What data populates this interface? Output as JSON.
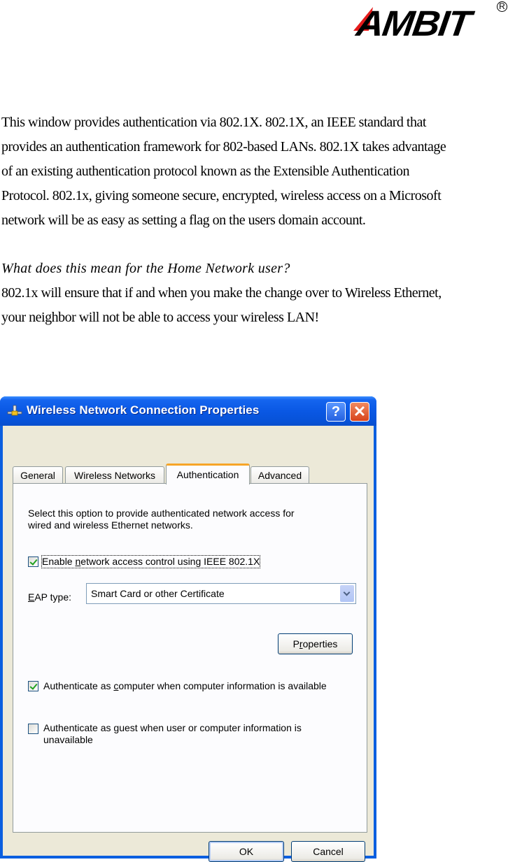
{
  "logo": {
    "text": "AMBIT",
    "registered": "R"
  },
  "intro_paragraph": {
    "lines": [
      "This window provides authentication via 802.1X. 802.1X, an IEEE standard that",
      "provides an authentication framework for 802-based LANs. 802.1X takes advantage",
      "of an existing authentication protocol known as the Extensible Authentication",
      "Protocol. 802.1x, giving someone secure, encrypted, wireless access on a Microsoft",
      "network will be as easy as setting a flag on the users domain account."
    ]
  },
  "question": "What does this mean for the Home Network user?",
  "answer": {
    "lines": [
      "802.1x will ensure that if and when you make the change over to Wireless Ethernet,",
      "your neighbor will not be able to access your wireless LAN!"
    ]
  },
  "dialog": {
    "title": "Wireless Network Connection Properties",
    "title_icon": "network-connection-icon",
    "help_label": "?",
    "close_label": "✕",
    "tabs": [
      {
        "label": "General",
        "active": false
      },
      {
        "label": "Wireless Networks",
        "active": false
      },
      {
        "label": "Authentication",
        "active": true
      },
      {
        "label": "Advanced",
        "active": false
      }
    ],
    "description_lines": [
      "Select this option to provide authenticated network access for",
      "wired and wireless Ethernet networks."
    ],
    "enable_8021x": {
      "pre": "Enable ",
      "accel": "n",
      "post": "etwork access control using IEEE 802.1X",
      "checked": true
    },
    "eap_type": {
      "label_accel": "E",
      "label_rest": "AP type:",
      "value": "Smart Card or other Certificate"
    },
    "properties_button": {
      "pre": "P",
      "accel": "r",
      "post": "operties"
    },
    "auth_computer": {
      "pre": "Authenticate as ",
      "accel": "c",
      "post": "omputer when computer information is available",
      "checked": true
    },
    "auth_guest": {
      "pre": "Authenticate as ",
      "accel": "g",
      "post": "uest when user or computer information is",
      "line2": "unavailable",
      "checked": false
    },
    "ok_label": "OK",
    "cancel_label": "Cancel"
  }
}
